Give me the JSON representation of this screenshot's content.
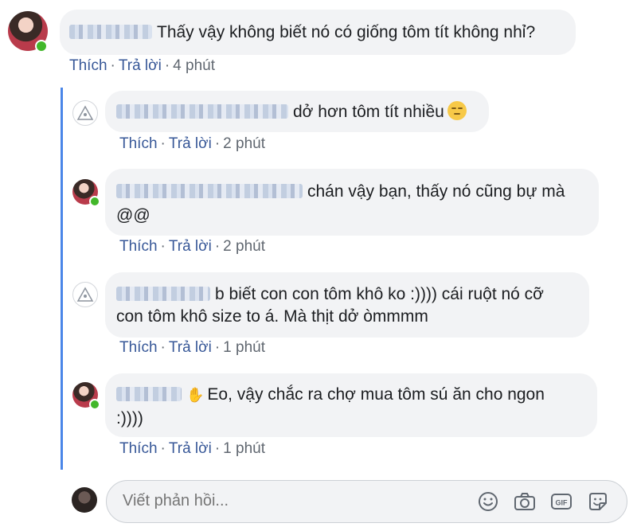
{
  "actions": {
    "like": "Thích",
    "reply": "Trả lời",
    "separator": "·"
  },
  "comments": [
    {
      "text": "Thấy vậy không biết nó có giống tôm tít không nhỉ?",
      "time": "4 phút",
      "avatar": "photo-avatar",
      "online": true
    },
    {
      "text": "dở hơn tôm tít nhiều",
      "emoji": "unamused-face-emoji",
      "time": "2 phút",
      "avatar": "logo-avatar",
      "online": false
    },
    {
      "text_line1": "chán vậy bạn, thấy nó cũng bự mà",
      "text_line2": "@@",
      "time": "2 phút",
      "avatar": "photo-avatar",
      "online": true
    },
    {
      "text_line1": "b biết con con tôm khô ko :)))) cái ruột nó cỡ",
      "text_line2": "con tôm khô size to á. Mà thịt dở òmmmm",
      "time": "1 phút",
      "avatar": "logo-avatar",
      "online": false
    },
    {
      "text_line1": "Eo, vậy chắc ra chợ mua tôm sú ăn cho ngon",
      "text_line2": ":))))",
      "icon": "waving-hand-icon",
      "time": "1 phút",
      "avatar": "photo-avatar",
      "online": true
    }
  ],
  "reply_box": {
    "placeholder": "Viết phản hồi...",
    "icons": [
      "emoji-icon",
      "camera-icon",
      "gif-icon",
      "sticker-icon"
    ]
  },
  "colors": {
    "link": "#385898",
    "thread_line": "#4a86e8",
    "bubble": "#f2f3f5",
    "online": "#42b72a"
  }
}
